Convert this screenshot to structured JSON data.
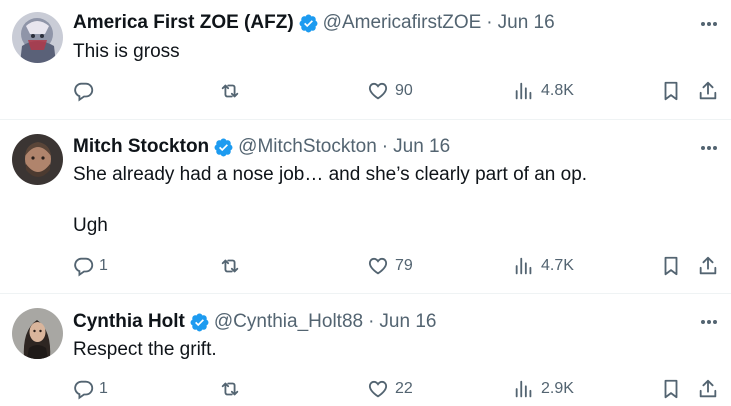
{
  "colors": {
    "text_primary": "#0f1419",
    "text_secondary": "#536471",
    "verified_blue": "#1d9bf0",
    "divider": "#eff3f4"
  },
  "tweets": [
    {
      "name": "America First ZOE (AFZ)",
      "handle": "@AmericafirstZOE",
      "separator": "·",
      "time": "Jun 16",
      "lines": [
        "This is gross"
      ],
      "reply_count": "",
      "retweet_count": "",
      "like_count": "90",
      "view_count": "4.8K",
      "verified": true
    },
    {
      "name": "Mitch Stockton",
      "handle": "@MitchStockton",
      "separator": "·",
      "time": "Jun 16",
      "lines": [
        "She already had a nose job… and she’s clearly part of an op.",
        "Ugh"
      ],
      "reply_count": "1",
      "retweet_count": "",
      "like_count": "79",
      "view_count": "4.7K",
      "verified": true
    },
    {
      "name": "Cynthia Holt",
      "handle": "@Cynthia_Holt88",
      "separator": "·",
      "time": "Jun 16",
      "lines": [
        "Respect the grift."
      ],
      "reply_count": "1",
      "retweet_count": "",
      "like_count": "22",
      "view_count": "2.9K",
      "verified": true
    }
  ]
}
